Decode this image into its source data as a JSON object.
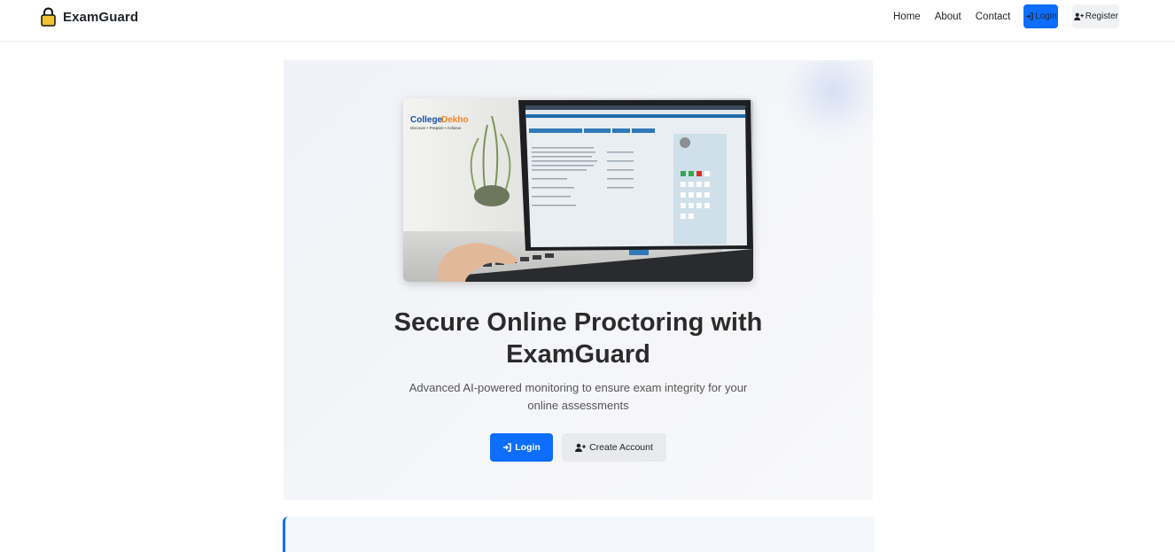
{
  "brand": {
    "name": "ExamGuard",
    "icon": "lock-icon",
    "icon_color": "#f2c230"
  },
  "nav": {
    "home": "Home",
    "about": "About",
    "contact": "Contact",
    "login": "Login",
    "register": "Register"
  },
  "hero": {
    "title_line1": "Secure Online Proctoring with",
    "title_line2": "ExamGuard",
    "subtitle_line1": "Advanced AI-powered monitoring to ensure exam integrity for your",
    "subtitle_line2": "online assessments",
    "login_button": "Login",
    "create_button": "Create Account",
    "image": {
      "logo_text_college": "College",
      "logo_text_dekho": "Dekho",
      "logo_tagline": "Discover • Prepare • Achieve"
    }
  },
  "colors": {
    "primary": "#0d6efd",
    "secondary_button": "#e9eaec",
    "hero_bg": "#f0f2f7"
  }
}
